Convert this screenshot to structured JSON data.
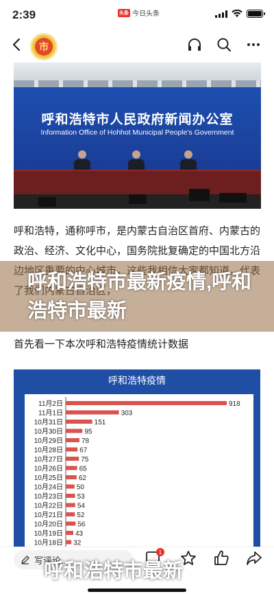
{
  "status": {
    "time": "2:39",
    "app_name": "今日头条",
    "app_logo": "头条"
  },
  "nav": {
    "avatar_text": "市"
  },
  "hero": {
    "title": "呼和浩特市人民政府新闻办公室",
    "subtitle": "Information Office of Hohhot Municipal People's Government"
  },
  "article": {
    "para1": "呼和浩特，通称呼市，是内蒙古自治区首府、内蒙古的政治、经济、文化中心，国务院批复确定的中国北方沿边地区重要的中心城市。这些我相信大家都知道，代表了我们内蒙古自治区，",
    "para2": "首先看一下本次呼和浩特疫情统计数据"
  },
  "overlay": {
    "title": "呼和浩特市最新疫情,呼和浩特市最新"
  },
  "chart_data": {
    "type": "bar",
    "title": "呼和浩特疫情",
    "orientation": "horizontal",
    "categories": [
      "11月2日",
      "11月1日",
      "10月31日",
      "10月30日",
      "10月29日",
      "10月28日",
      "10月27日",
      "10月26日",
      "10月25日",
      "10月24日",
      "10月23日",
      "10月22日",
      "10月21日",
      "10月20日",
      "10月19日",
      "10月18日"
    ],
    "values": [
      918,
      303,
      151,
      95,
      78,
      67,
      75,
      65,
      62,
      50,
      53,
      54,
      52,
      56,
      43,
      32
    ],
    "colors": {
      "bar": "#d9534f",
      "background": "#ffffff",
      "frame": "#1f4ea5"
    }
  },
  "bottom": {
    "comment_placeholder": "写评论...",
    "badge_count": "1"
  },
  "overlay2": {
    "title": "呼和浩特市最新"
  }
}
